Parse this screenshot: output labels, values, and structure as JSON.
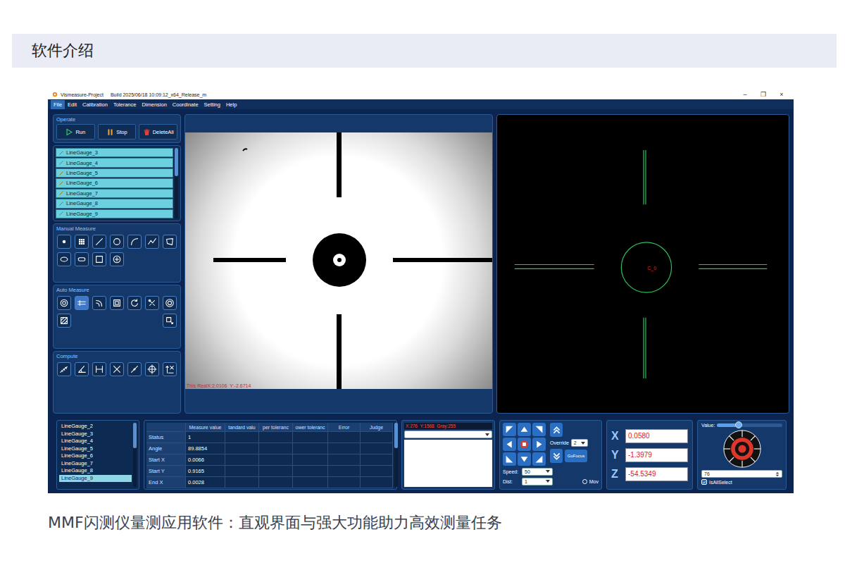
{
  "section_title": "软件介绍",
  "window": {
    "title": "Vismeasure-Project",
    "build": "Build 2025/06/18 10:09:12_x64_Release_m",
    "controls": [
      "–",
      "❐",
      "×"
    ]
  },
  "menu": [
    {
      "label": "File",
      "selected": true
    },
    {
      "label": "Edit",
      "selected": false
    },
    {
      "label": "Calibration",
      "selected": false
    },
    {
      "label": "Tolerance",
      "selected": false
    },
    {
      "label": "Dimension",
      "selected": false
    },
    {
      "label": "Coordinate",
      "selected": false
    },
    {
      "label": "Setting",
      "selected": false
    },
    {
      "label": "Help",
      "selected": false
    }
  ],
  "operate": {
    "title": "Operate",
    "buttons": [
      {
        "label": "Run",
        "kind": "run"
      },
      {
        "label": "Stop",
        "kind": "stop"
      },
      {
        "label": "DeleteAll",
        "kind": "delete"
      }
    ]
  },
  "gauge_list": [
    "LineGauge_3",
    "LineGauge_4",
    "LineGauge_5",
    "LineGauge_6",
    "LineGauge_7",
    "LineGauge_8",
    "LineGauge_9"
  ],
  "manual_measure": {
    "title": "Manual Measure",
    "tools": [
      {
        "kind": "point"
      },
      {
        "kind": "grid"
      },
      {
        "kind": "line"
      },
      {
        "kind": "circle"
      },
      {
        "kind": "arc"
      },
      {
        "kind": "polyline"
      },
      {
        "kind": "polygon"
      },
      {
        "kind": "ellipse"
      },
      {
        "kind": "slot"
      },
      {
        "kind": "rect"
      },
      {
        "kind": "target"
      }
    ]
  },
  "auto_measure": {
    "title": "Auto Measure",
    "tools": [
      {
        "kind": "auto-circle",
        "selected": false
      },
      {
        "kind": "auto-line",
        "selected": true
      },
      {
        "kind": "auto-arc",
        "selected": false
      },
      {
        "kind": "auto-rect",
        "selected": false
      },
      {
        "kind": "auto-arc2",
        "selected": false
      },
      {
        "kind": "connect",
        "selected": false
      },
      {
        "kind": "ring",
        "selected": false
      },
      {
        "kind": "region",
        "selected": false
      },
      {
        "kind": "pattern",
        "selected": false
      }
    ]
  },
  "compute": {
    "title": "Compute",
    "tools": [
      {
        "kind": "distance"
      },
      {
        "kind": "angle"
      },
      {
        "kind": "width"
      },
      {
        "kind": "intersect"
      },
      {
        "kind": "midpoint"
      },
      {
        "kind": "center"
      },
      {
        "kind": "coord"
      }
    ]
  },
  "image_view": {
    "readout": "This RealX:2.0106  Y:-2.6714"
  },
  "graphics_view": {
    "label": "C_0"
  },
  "result_list": [
    {
      "label": "LineGauge_2",
      "selected": false
    },
    {
      "label": "LineGauge_3",
      "selected": false
    },
    {
      "label": "LineGauge_4",
      "selected": false
    },
    {
      "label": "LineGauge_5",
      "selected": false
    },
    {
      "label": "LineGauge_6",
      "selected": false
    },
    {
      "label": "LineGauge_7",
      "selected": false
    },
    {
      "label": "LineGauge_8",
      "selected": false
    },
    {
      "label": "LineGauge_9",
      "selected": true
    }
  ],
  "result_table": {
    "columns": [
      "",
      "Measure value",
      "tandard valu",
      "per toleranc",
      "ower toleranc",
      "Error",
      "Judge"
    ],
    "rows": [
      [
        "Status",
        "1"
      ],
      [
        "Angle",
        "89.8854"
      ],
      [
        "Start X",
        "0.0066"
      ],
      [
        "Start Y",
        "0.9165"
      ],
      [
        "End X",
        "0.0028"
      ]
    ]
  },
  "pixel_info": {
    "readout": "X:276  Y:1568  Gray:255"
  },
  "motion": {
    "pad": [
      {
        "kind": "up-left"
      },
      {
        "kind": "up"
      },
      {
        "kind": "up-right"
      },
      {
        "kind": "left"
      },
      {
        "kind": "stop"
      },
      {
        "kind": "right"
      },
      {
        "kind": "down-left"
      },
      {
        "kind": "down"
      },
      {
        "kind": "down-right"
      }
    ],
    "override": {
      "label": "Override",
      "value": "2"
    },
    "go_focus": "GoFocus",
    "speed": {
      "label": "Speed:",
      "value": "50"
    },
    "dist": {
      "label": "Dist:",
      "value": "1"
    },
    "move": {
      "label": "Mov",
      "checked": false
    }
  },
  "coordinates": [
    {
      "axis": "X",
      "value": "0.0580"
    },
    {
      "axis": "Y",
      "value": "-1.3979"
    },
    {
      "axis": "Z",
      "value": "-54.5349"
    }
  ],
  "light": {
    "label": "Value:",
    "level": 0.33,
    "channel": "76",
    "all_select": {
      "label": "IsAllSelect",
      "checked": true
    }
  },
  "caption": "MMF闪测仪量测应用软件：直观界面与强大功能助力高效测量任务"
}
